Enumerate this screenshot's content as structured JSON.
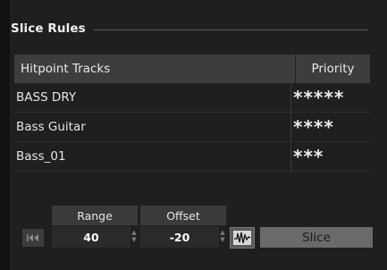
{
  "header": {
    "title": "Slice Rules"
  },
  "table": {
    "columns": [
      "Hitpoint Tracks",
      "Priority"
    ],
    "rows": [
      {
        "name": "BASS DRY",
        "priority": "*****"
      },
      {
        "name": "Bass Guitar",
        "priority": "****"
      },
      {
        "name": "Bass_01",
        "priority": "***"
      }
    ]
  },
  "controls": {
    "range": {
      "label": "Range",
      "value": "40"
    },
    "offset": {
      "label": "Offset",
      "value": "-20"
    },
    "slice_button": "Slice",
    "icons": [
      "skip-to-start-icon",
      "waveform-icon",
      "spin-up-icon",
      "spin-down-icon"
    ]
  },
  "colors": {
    "background": "#1f1f1f",
    "table_header": "#3d3d3d",
    "slice_button": "#6a6a6a"
  }
}
